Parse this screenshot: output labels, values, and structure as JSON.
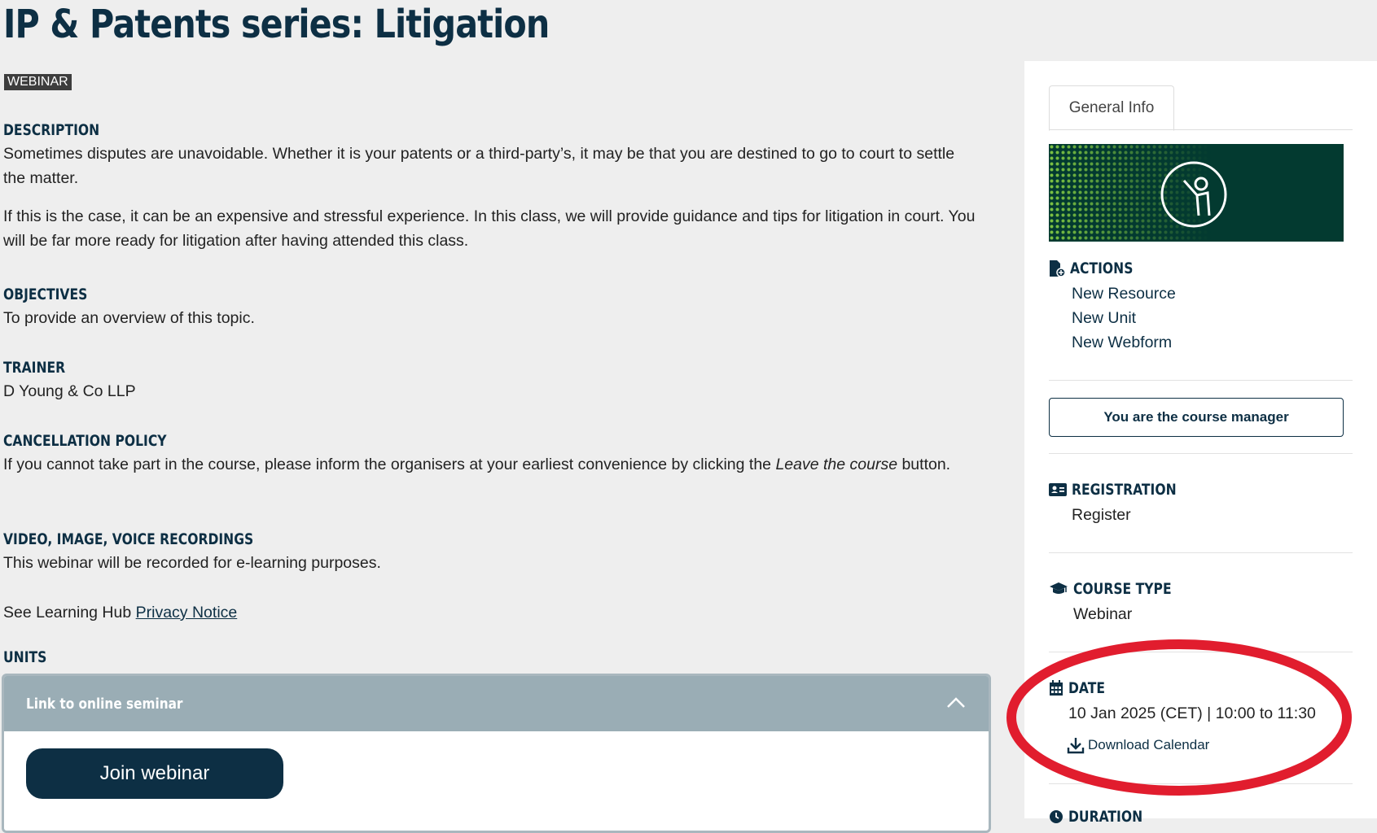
{
  "page": {
    "title": "IP & Patents series: Litigation",
    "badge": "WEBINAR"
  },
  "sections": {
    "description": {
      "heading": "DESCRIPTION",
      "p1": "Sometimes disputes are unavoidable. Whether it is your patents or a third-party’s, it may be that you are destined to go to court to settle the matter.",
      "p2": "If this is the case, it can be an expensive and stressful experience. In this class, we will provide guidance and tips for litigation in court. You will be far more ready for litigation after having attended this class."
    },
    "objectives": {
      "heading": "OBJECTIVES",
      "text": "To provide an overview of this topic."
    },
    "trainer": {
      "heading": "TRAINER",
      "text": "D Young & Co LLP"
    },
    "cancellation": {
      "heading": "CANCELLATION POLICY",
      "text_before": "If you cannot take part in the course, please inform the organisers at your earliest convenience by clicking the ",
      "text_em": "Leave the course",
      "text_after": " button."
    },
    "recordings": {
      "heading": "VIDEO, IMAGE, VOICE RECORDINGS",
      "text": "This webinar will be recorded for e-learning purposes.",
      "privacy_prefix": "See Learning Hub ",
      "privacy_link": "Privacy Notice"
    },
    "units": {
      "heading": "UNITS",
      "unit_title": "Link to online seminar",
      "join_label": "Join webinar"
    }
  },
  "sidebar": {
    "tab": "General Info",
    "actions": {
      "heading": "ACTIONS",
      "items": [
        "New Resource",
        "New Unit",
        "New Webform"
      ]
    },
    "manager_button": "You are the course manager",
    "registration": {
      "heading": "REGISTRATION",
      "value": "Register"
    },
    "course_type": {
      "heading": "COURSE TYPE",
      "value": "Webinar"
    },
    "date": {
      "heading": "DATE",
      "value": "10 Jan 2025 (CET) | 10:00 to 11:30",
      "download": "Download Calendar"
    },
    "next_heading_partial": "DURATION"
  },
  "colors": {
    "brand_dark": "#0d2f44",
    "highlight_circle": "#e11d2e",
    "unit_header": "#9aadb5",
    "banner_bg": "#033a30",
    "banner_dots": "#7cc242"
  },
  "icons": [
    "file-plus-icon",
    "id-card-icon",
    "graduation-cap-icon",
    "calendar-icon",
    "download-icon",
    "chevron-up-icon",
    "presenter-icon"
  ]
}
